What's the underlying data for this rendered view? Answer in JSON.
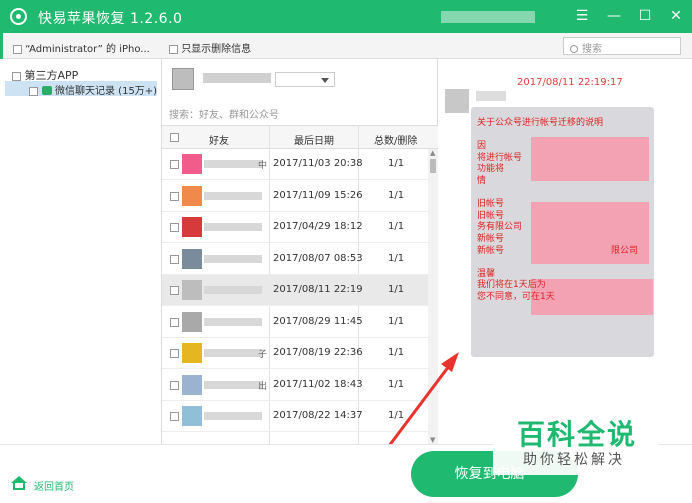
{
  "colors": {
    "accent": "#1fb970",
    "red_text": "#e03c3c",
    "selection": "#cde3f3"
  },
  "title_bar": {
    "app_name": "快易苹果恢复  1.2.6.0",
    "logo_icon": "app-logo-icon",
    "buttons": {
      "menu": "☰",
      "minimize": "—",
      "maximize": "☐",
      "close": "✕"
    }
  },
  "toolbar": {
    "device_label": "“Administrator” 的 iPho...",
    "show_deleted_label": "只显示删除信息",
    "search_placeholder": "搜索"
  },
  "tree": {
    "root_label": "第三方APP",
    "wechat_label": "微信聊天记录 (15万+)"
  },
  "middle": {
    "filter_placeholder": "搜索：好友、群和公众号",
    "columns": {
      "friend": "好友",
      "last_date": "最后日期",
      "total_deleted": "总数/删除"
    },
    "rows": [
      {
        "date": "2017/11/03 20:38",
        "count": "1/1",
        "avatar_color": "#f25c8c",
        "blurred_suffix": "中"
      },
      {
        "date": "2017/11/09 15:26",
        "count": "1/1",
        "avatar_color": "#f08a4b",
        "blurred_suffix": ""
      },
      {
        "date": "2017/04/29 18:12",
        "count": "1/1",
        "avatar_color": "#d63a3a",
        "blurred_suffix": ""
      },
      {
        "date": "2017/08/07 08:53",
        "count": "1/1",
        "avatar_color": "#7a8b9c",
        "blurred_suffix": ""
      },
      {
        "date": "2017/08/11 22:19",
        "count": "1/1",
        "avatar_color": "#bdbdbd",
        "blurred_suffix": ""
      },
      {
        "date": "2017/08/29 11:45",
        "count": "1/1",
        "avatar_color": "#a9a9a9",
        "blurred_suffix": ""
      },
      {
        "date": "2017/08/19 22:36",
        "count": "1/1",
        "avatar_color": "#e5b622",
        "blurred_suffix": "子"
      },
      {
        "date": "2017/11/02 18:43",
        "count": "1/1",
        "avatar_color": "#9bb3d1",
        "blurred_suffix": "出"
      },
      {
        "date": "2017/08/22 14:37",
        "count": "1/1",
        "avatar_color": "#8fc0d8",
        "blurred_suffix": ""
      }
    ]
  },
  "message": {
    "timestamp": "2017/08/11 22:19:17",
    "lines": [
      "关于公众号进行帐号迁移的说明",
      "",
      "因",
      "将进行帐号",
      "功能将",
      "情",
      "",
      "旧帐号",
      "旧帐号",
      "务有限公司",
      "新帐号",
      "新帐号",
      "",
      "温馨",
      "我们将在1天后为",
      "您不同意，可在1天"
    ],
    "line_tails": [
      "",
      "",
      "",
      "",
      "",
      "",
      "",
      "",
      "",
      "",
      "",
      "限公司",
      "",
      "",
      "",
      ""
    ]
  },
  "footer": {
    "home_label": "返回首页",
    "restore_label": "恢复到电脑"
  },
  "watermark": {
    "big": "百科全说",
    "small": "助你轻松解决"
  }
}
